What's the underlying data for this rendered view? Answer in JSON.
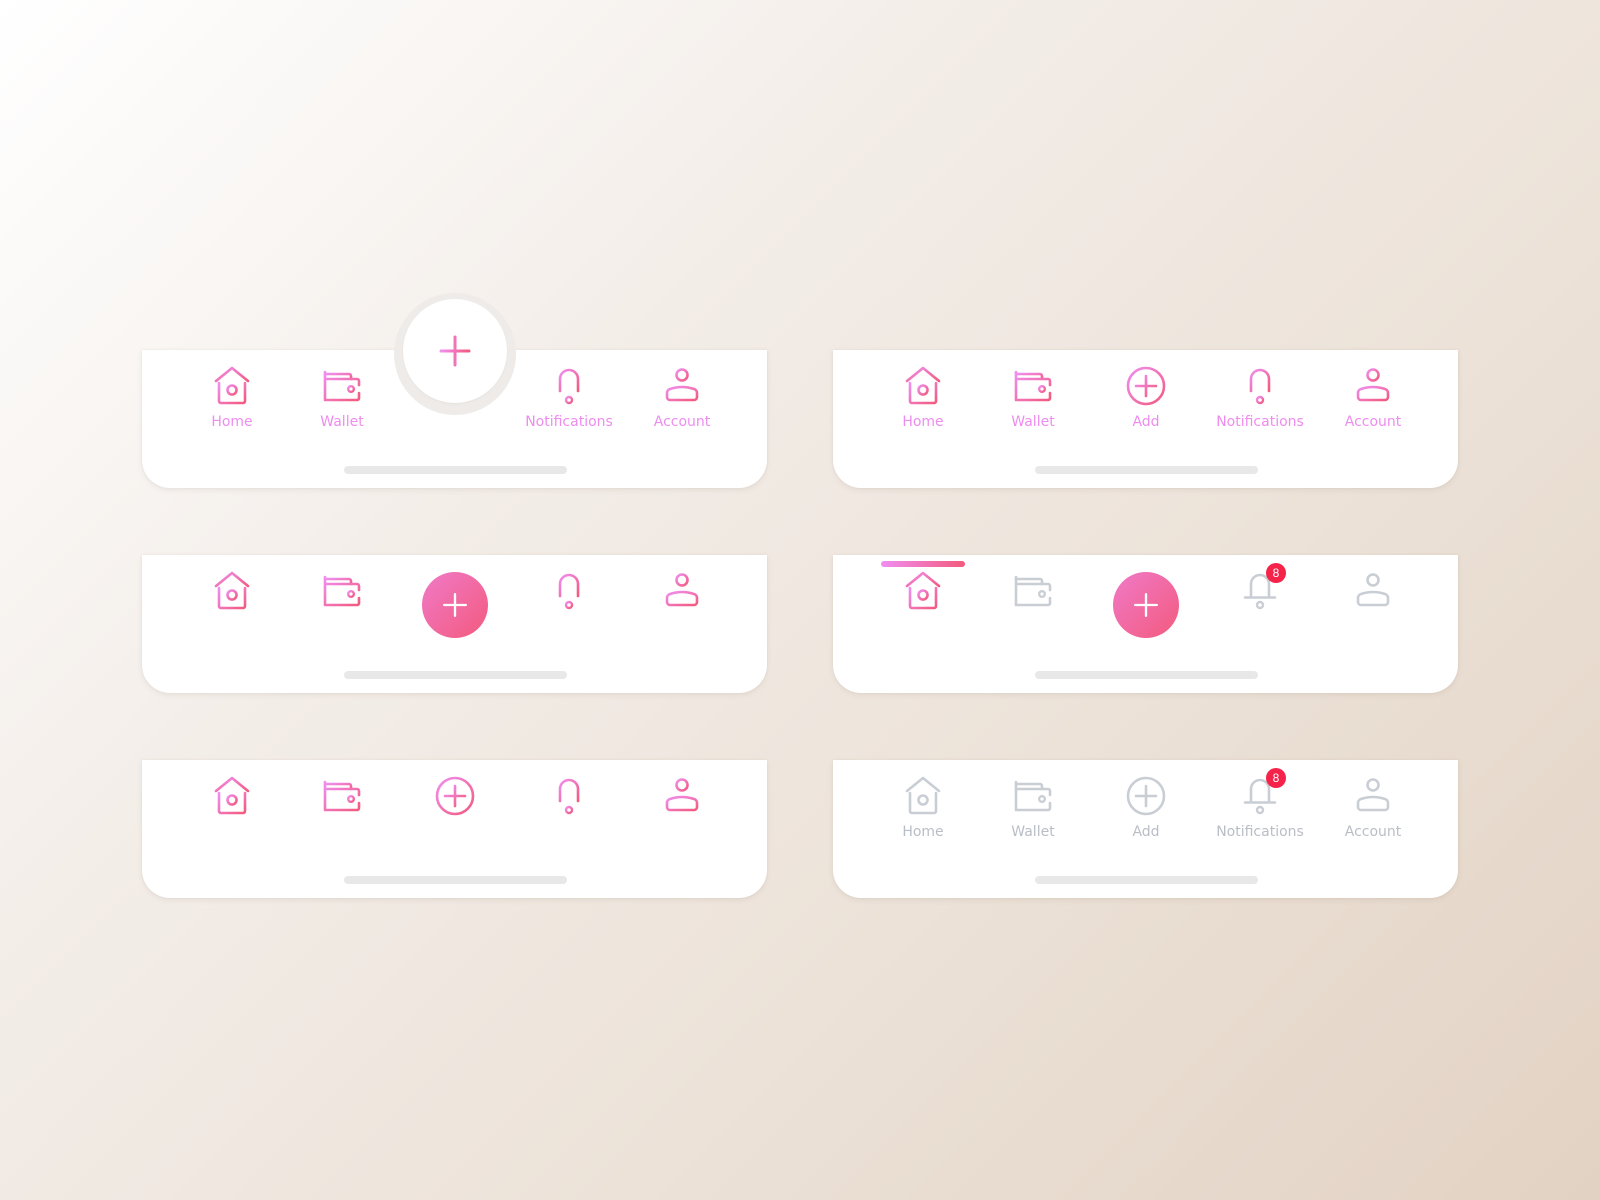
{
  "colors": {
    "accent_start": "#f08ef0",
    "accent_end": "#f35a7e",
    "label_active": "#ee8cf0",
    "inactive": "#b9bec6",
    "badge": "#f5234a",
    "home_indicator": "#e8e8e8"
  },
  "labels": {
    "home": "Home",
    "wallet": "Wallet",
    "add": "Add",
    "notifications": "Notifications",
    "account": "Account"
  },
  "variants": [
    {
      "id": "notched-fab-with-labels",
      "style": "active",
      "labels_shown": true,
      "center": "notched-fab"
    },
    {
      "id": "inline-add-with-labels",
      "style": "active",
      "labels_shown": true,
      "center": "outline-add"
    },
    {
      "id": "filled-fab-no-labels",
      "style": "active",
      "labels_shown": false,
      "center": "filled-fab"
    },
    {
      "id": "filled-fab-home-selected",
      "style": "selected-home",
      "labels_shown": false,
      "center": "filled-fab",
      "selected": "Home"
    },
    {
      "id": "outline-add-no-labels",
      "style": "active",
      "labels_shown": false,
      "center": "outline-add"
    },
    {
      "id": "muted-with-labels",
      "style": "muted",
      "labels_shown": true,
      "center": "outline-add"
    }
  ],
  "notifications_badge": "8"
}
